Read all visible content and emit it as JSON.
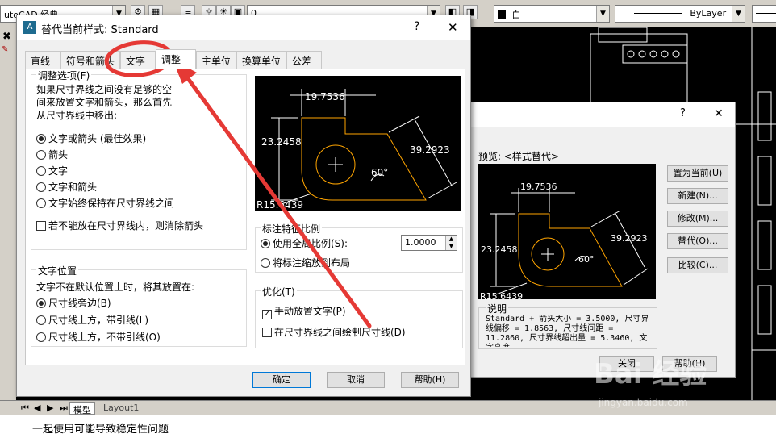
{
  "toolbar": {
    "workspace_combo": "utoCAD 经典",
    "color_combo": "白",
    "linetype_combo": "ByLayer",
    "layer_value": "0"
  },
  "background_dialog": {
    "preview_label": "预览: <样式替代>",
    "buttons": [
      "置为当前(U)",
      "新建(N)...",
      "修改(M)...",
      "替代(O)...",
      "比较(C)..."
    ],
    "description_label": "说明",
    "description_text": "Standard + 箭头大小 = 3.5000, 尺寸界线偏移 = 1.8563, 尺寸线间距 = 11.2860, 尺寸界线超出量 = 5.3460, 文字高度 ...",
    "close_button": "关闭",
    "help_button": "帮助(H)",
    "help_glyph": "?",
    "close_glyph": "✕",
    "dims": {
      "width": "19.7536",
      "height": "23.2458",
      "slant": "39.2923",
      "angle": "60°",
      "radius": "R15.6439"
    }
  },
  "dialog": {
    "title": "替代当前样式: Standard",
    "help_glyph": "?",
    "close_glyph": "✕",
    "tabs": [
      "直线",
      "符号和箭头",
      "文字",
      "调整",
      "主单位",
      "换算单位",
      "公差"
    ],
    "active_tab": "调整",
    "fit_group": {
      "legend": "调整选项(F)",
      "description": "如果尺寸界线之间没有足够的空间来放置文字和箭头，那么首先从尺寸界线中移出:",
      "options": [
        "文字或箭头 (最佳效果)",
        "箭头",
        "文字",
        "文字和箭头",
        "文字始终保持在尺寸界线之间"
      ],
      "selected_index": 0,
      "suppress_label": "若不能放在尺寸界线内，则消除箭头",
      "suppress_checked": false
    },
    "text_group": {
      "legend": "文字位置",
      "description": "文字不在默认位置上时，将其放置在:",
      "options": [
        "尺寸线旁边(B)",
        "尺寸线上方，带引线(L)",
        "尺寸线上方，不带引线(O)"
      ],
      "selected_index": 0
    },
    "scale_group": {
      "legend": "标注特征比例",
      "use_global": "使用全局比例(S):",
      "scale_value": "1.0000",
      "scale_layout": "将标注缩放到布局",
      "selected_index": 0
    },
    "fine_group": {
      "legend": "优化(T)",
      "manual_text": "手动放置文字(P)",
      "manual_checked": true,
      "draw_between": "在尺寸界线之间绘制尺寸线(D)",
      "draw_checked": false
    },
    "ok_button": "确定",
    "cancel_button": "取消",
    "help_button": "帮助(H)",
    "dims": {
      "width": "19.7536",
      "height": "23.2458",
      "slant": "39.2923",
      "angle": "60°",
      "radius": "R15.6439"
    }
  },
  "bottom": {
    "model_tab": "模型",
    "layout_tab": "Layout1",
    "command_text": "一起使用可能导致稳定性问题"
  },
  "watermark": {
    "brand": "Bai 经验",
    "url": "jingyan.baidu.com"
  },
  "colors": {
    "annotation": "#e53935",
    "preview_line": "#ffa500"
  }
}
